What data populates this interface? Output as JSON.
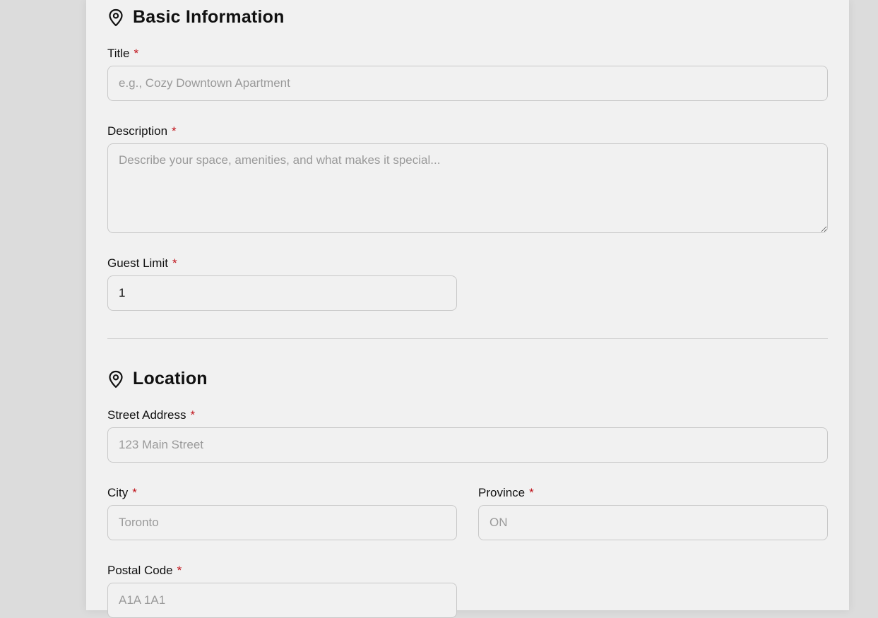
{
  "basic": {
    "heading": "Basic Information",
    "title_label": "Title",
    "title_placeholder": "e.g., Cozy Downtown Apartment",
    "description_label": "Description",
    "description_placeholder": "Describe your space, amenities, and what makes it special...",
    "guest_limit_label": "Guest Limit",
    "guest_limit_value": "1"
  },
  "location": {
    "heading": "Location",
    "street_label": "Street Address",
    "street_placeholder": "123 Main Street",
    "city_label": "City",
    "city_placeholder": "Toronto",
    "province_label": "Province",
    "province_placeholder": "ON",
    "postal_label": "Postal Code",
    "postal_placeholder": "A1A 1A1"
  },
  "required_mark": "*",
  "colors": {
    "required": "#c0131b",
    "card": "#f1f1f1",
    "backdrop": "#dcdcdc"
  },
  "icons": {
    "section": "map-pin-icon"
  }
}
